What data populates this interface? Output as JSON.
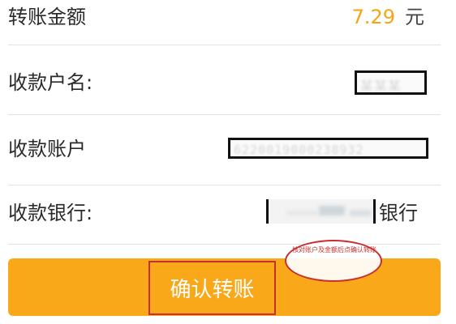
{
  "form": {
    "amount_label": "转账金额",
    "amount_value": "7.29",
    "amount_unit": "元",
    "payee_name_label": "收款户名:",
    "payee_name_masked": "某某某",
    "payee_account_label": "收款账户",
    "payee_account_masked": "6220019000238932",
    "payee_bank_label": "收款银行:",
    "payee_bank_suffix": "银行"
  },
  "actions": {
    "confirm_label": "确认转账"
  },
  "annotation": {
    "text": "核对账户及金额后点确认转账"
  },
  "colors": {
    "accent": "#f9a81a",
    "amount": "#f4a516",
    "annotation_red": "#c8302f",
    "divider": "#e3e3e3"
  }
}
